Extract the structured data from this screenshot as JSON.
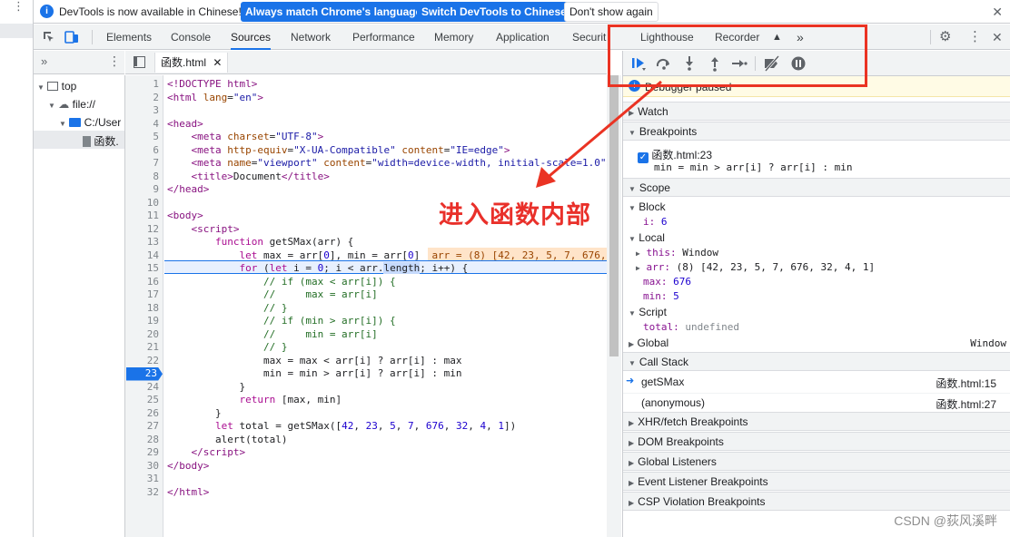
{
  "infobar": {
    "message": "DevTools is now available in Chinese!",
    "btn_match": "Always match Chrome's language",
    "btn_switch": "Switch DevTools to Chinese",
    "btn_dismiss": "Don't show again"
  },
  "tabs": [
    "Elements",
    "Console",
    "Sources",
    "Network",
    "Performance",
    "Memory",
    "Application",
    "Securit",
    "Lighthouse",
    "Recorder"
  ],
  "navigator": {
    "top": "top",
    "file": "file://",
    "folder": "C:/User",
    "file_item": "函数."
  },
  "editor": {
    "tab_label": "函数.html",
    "line_numbers": [
      "1",
      "2",
      "3",
      "4",
      "5",
      "6",
      "7",
      "8",
      "9",
      "10",
      "11",
      "12",
      "13",
      "14",
      "15",
      "16",
      "17",
      "18",
      "19",
      "20",
      "21",
      "22",
      "23",
      "24",
      "25",
      "26",
      "27",
      "28",
      "29",
      "30",
      "31",
      "32"
    ],
    "current_line": "23",
    "inline_value": "arr = (8) [42, 23, 5, 7, 676,"
  },
  "debugger": {
    "paused_banner": "Debugger paused",
    "watch": "Watch",
    "breakpoints": "Breakpoints",
    "bp_file": "函数.html:23",
    "bp_code": "min = min > arr[i] ? arr[i] : min",
    "scope": "Scope",
    "block": "Block",
    "block_i_key": "i:",
    "block_i_val": "6",
    "local": "Local",
    "local_this_key": "this:",
    "local_this_val": "Window",
    "local_arr_key": "arr:",
    "local_arr_val": "(8) [42, 23, 5, 7, 676, 32, 4, 1]",
    "local_max_key": "max:",
    "local_max_val": "676",
    "local_min_key": "min:",
    "local_min_val": "5",
    "script": "Script",
    "script_total_key": "total:",
    "script_total_val": "undefined",
    "global": "Global",
    "global_val": "Window",
    "call_stack": "Call Stack",
    "frame1_name": "getSMax",
    "frame1_loc": "函数.html:15",
    "frame2_name": "(anonymous)",
    "frame2_loc": "函数.html:27",
    "xhr": "XHR/fetch Breakpoints",
    "dom": "DOM Breakpoints",
    "global_listeners": "Global Listeners",
    "event_listener": "Event Listener Breakpoints",
    "csp": "CSP Violation Breakpoints"
  },
  "annotation": "进入函数内部",
  "watermark": "CSDN @荻风溪畔",
  "colors": {
    "accent": "#1a73e8",
    "annotation_red": "#ea3323",
    "line_highlight": "#e8f0fe"
  }
}
